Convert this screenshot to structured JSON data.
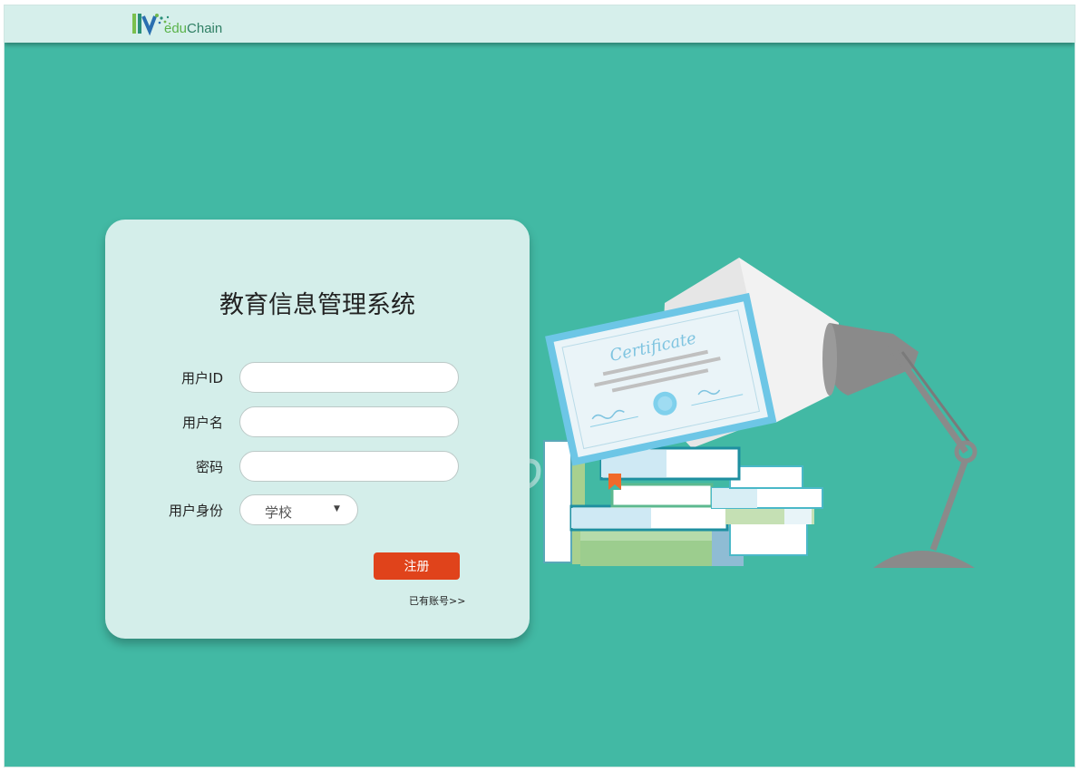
{
  "brand": {
    "logo_prefix": "edu",
    "logo_suffix": "Chain"
  },
  "form": {
    "title": "教育信息管理系统",
    "fields": [
      {
        "label": "用户ID",
        "value": "",
        "placeholder": ""
      },
      {
        "label": "用户名",
        "value": "",
        "placeholder": ""
      },
      {
        "label": "密码",
        "value": "",
        "placeholder": ""
      }
    ],
    "role": {
      "label": "用户身份",
      "selected": "学校"
    },
    "register_label": "注册",
    "login_link": "已有账号>>"
  },
  "illustration": {
    "certificate_text": "Certificate"
  },
  "colors": {
    "background": "#42b9a4",
    "header": "#d6efeb",
    "card": "#d4eeea",
    "primary_button": "#e0431b",
    "lamp": "#8a8a8a"
  }
}
